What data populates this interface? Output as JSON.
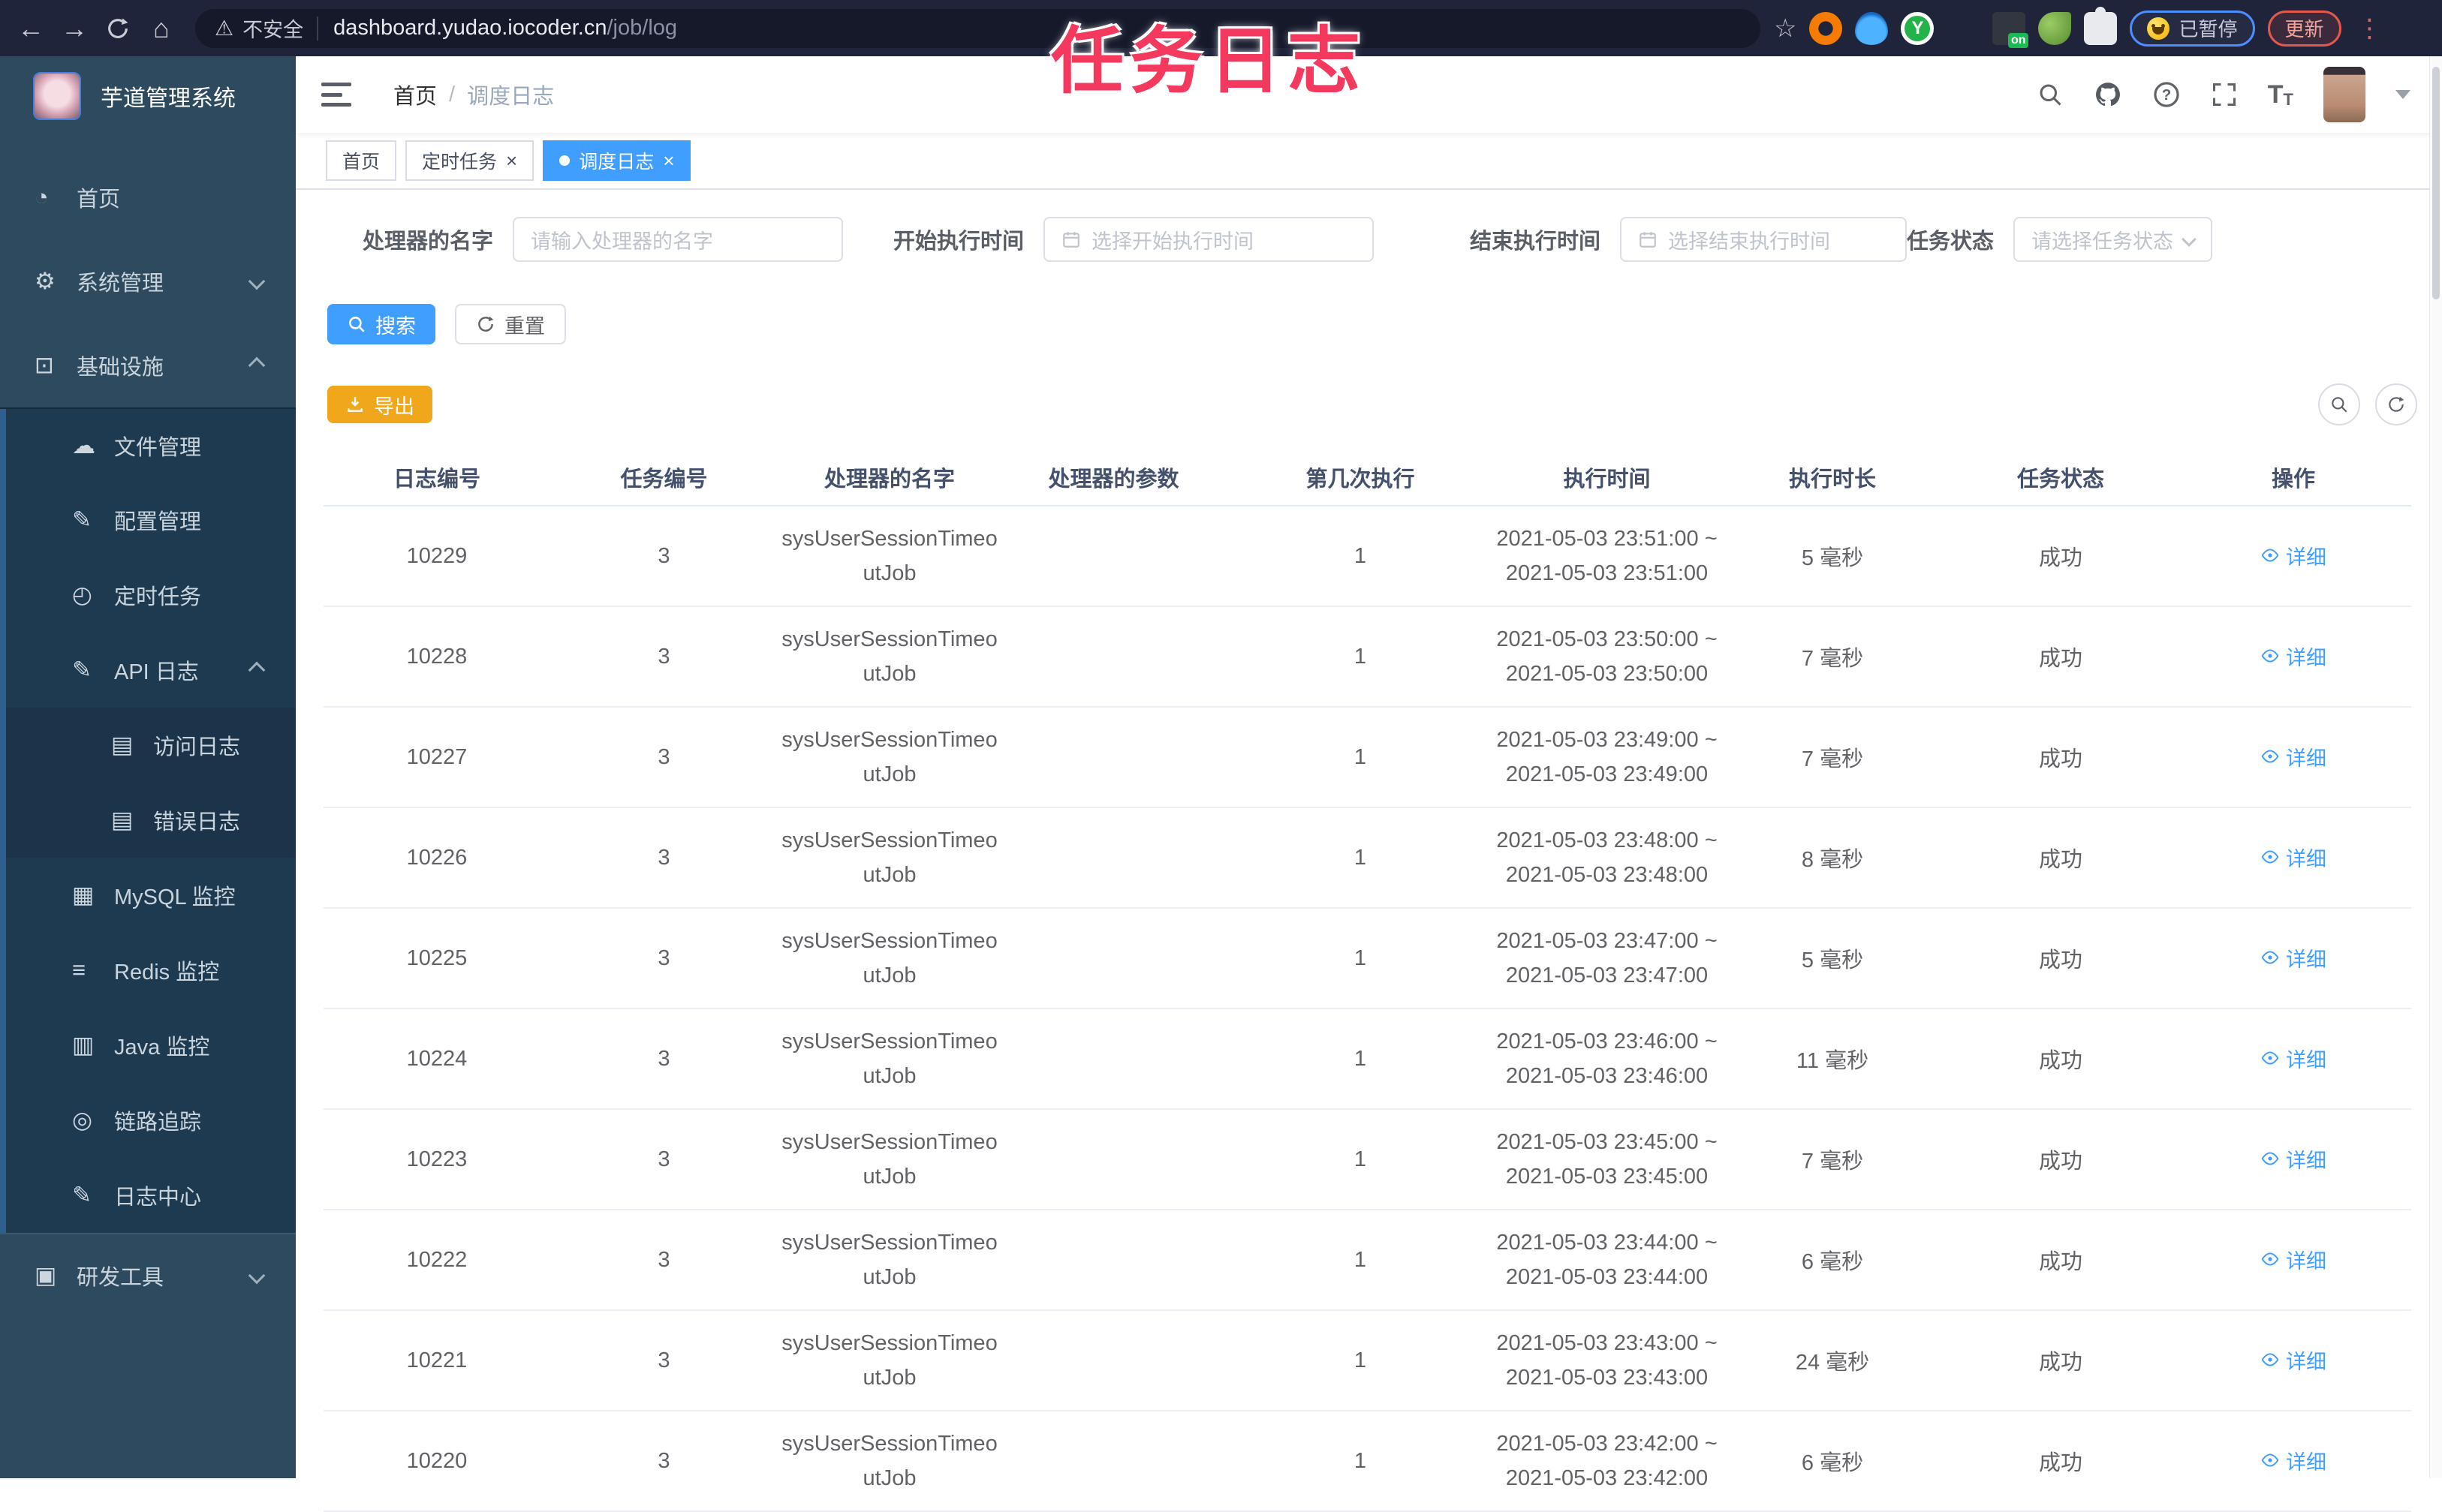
{
  "watermark": "任务日志",
  "browser": {
    "security_label": "不安全",
    "url_host": "dashboard.yudao.iocoder.cn",
    "url_path": "/job/log",
    "extension_badge": "on",
    "paused_badge": "已暂停",
    "update_badge": "更新"
  },
  "sidebar": {
    "app_title": "芋道管理系统",
    "items": [
      {
        "icon": "dashboard-icon",
        "label": "首页",
        "level": 1
      },
      {
        "icon": "gear-icon",
        "label": "系统管理",
        "level": 1,
        "chevron": "down"
      },
      {
        "icon": "infrastructure-icon",
        "label": "基础设施",
        "level": 1,
        "chevron": "up"
      },
      {
        "icon": "cloud-upload-icon",
        "label": "文件管理",
        "level": 2
      },
      {
        "icon": "edit-icon",
        "label": "配置管理",
        "level": 2
      },
      {
        "icon": "timer-icon",
        "label": "定时任务",
        "level": 2
      },
      {
        "icon": "api-log-icon",
        "label": "API 日志",
        "level": 2,
        "chevron": "up"
      },
      {
        "icon": "access-log-icon",
        "label": "访问日志",
        "level": 3
      },
      {
        "icon": "error-log-icon",
        "label": "错误日志",
        "level": 3
      },
      {
        "icon": "mysql-icon",
        "label": "MySQL 监控",
        "level": 2
      },
      {
        "icon": "redis-icon",
        "label": "Redis 监控",
        "level": 2
      },
      {
        "icon": "java-icon",
        "label": "Java 监控",
        "level": 2
      },
      {
        "icon": "trace-icon",
        "label": "链路追踪",
        "level": 2
      },
      {
        "icon": "log-center-icon",
        "label": "日志中心",
        "level": 2
      },
      {
        "icon": "toolbox-icon",
        "label": "研发工具",
        "level": 1,
        "chevron": "down"
      }
    ]
  },
  "header": {
    "breadcrumb_home": "首页",
    "breadcrumb_sep": "/",
    "breadcrumb_current": "调度日志"
  },
  "tabs": [
    {
      "label": "首页"
    },
    {
      "label": "定时任务",
      "closable": true
    },
    {
      "label": "调度日志",
      "closable": true,
      "active": true
    }
  ],
  "filters": [
    {
      "label": "处理器的名字",
      "placeholder": "请输入处理器的名字"
    },
    {
      "label": "开始执行时间",
      "placeholder": "选择开始执行时间",
      "date_icon": true
    },
    {
      "label": "结束执行时间",
      "placeholder": "选择结束执行时间",
      "date_icon": true
    },
    {
      "label": "任务状态",
      "placeholder": "请选择任务状态",
      "select_chevron": true
    }
  ],
  "actions": {
    "search_label": "搜索",
    "reset_label": "重置",
    "export_label": "导出"
  },
  "table": {
    "columns": [
      "日志编号",
      "任务编号",
      "处理器的名字",
      "处理器的参数",
      "第几次执行",
      "执行时间",
      "执行时长",
      "任务状态",
      "操作"
    ],
    "time_joiner": "~",
    "action_label": "详细",
    "rows": [
      {
        "log_id": "10229",
        "job_id": "3",
        "handler_name": "sysUserSessionTimeoutJob",
        "param": "",
        "exec_index": "1",
        "exec_time_start": "2021-05-03 23:51:00",
        "exec_time_end": "2021-05-03 23:51:00",
        "duration": "5 毫秒",
        "status": "成功"
      },
      {
        "log_id": "10228",
        "job_id": "3",
        "handler_name": "sysUserSessionTimeoutJob",
        "param": "",
        "exec_index": "1",
        "exec_time_start": "2021-05-03 23:50:00",
        "exec_time_end": "2021-05-03 23:50:00",
        "duration": "7 毫秒",
        "status": "成功"
      },
      {
        "log_id": "10227",
        "job_id": "3",
        "handler_name": "sysUserSessionTimeoutJob",
        "param": "",
        "exec_index": "1",
        "exec_time_start": "2021-05-03 23:49:00",
        "exec_time_end": "2021-05-03 23:49:00",
        "duration": "7 毫秒",
        "status": "成功"
      },
      {
        "log_id": "10226",
        "job_id": "3",
        "handler_name": "sysUserSessionTimeoutJob",
        "param": "",
        "exec_index": "1",
        "exec_time_start": "2021-05-03 23:48:00",
        "exec_time_end": "2021-05-03 23:48:00",
        "duration": "8 毫秒",
        "status": "成功"
      },
      {
        "log_id": "10225",
        "job_id": "3",
        "handler_name": "sysUserSessionTimeoutJob",
        "param": "",
        "exec_index": "1",
        "exec_time_start": "2021-05-03 23:47:00",
        "exec_time_end": "2021-05-03 23:47:00",
        "duration": "5 毫秒",
        "status": "成功"
      },
      {
        "log_id": "10224",
        "job_id": "3",
        "handler_name": "sysUserSessionTimeoutJob",
        "param": "",
        "exec_index": "1",
        "exec_time_start": "2021-05-03 23:46:00",
        "exec_time_end": "2021-05-03 23:46:00",
        "duration": "11 毫秒",
        "status": "成功"
      },
      {
        "log_id": "10223",
        "job_id": "3",
        "handler_name": "sysUserSessionTimeoutJob",
        "param": "",
        "exec_index": "1",
        "exec_time_start": "2021-05-03 23:45:00",
        "exec_time_end": "2021-05-03 23:45:00",
        "duration": "7 毫秒",
        "status": "成功"
      },
      {
        "log_id": "10222",
        "job_id": "3",
        "handler_name": "sysUserSessionTimeoutJob",
        "param": "",
        "exec_index": "1",
        "exec_time_start": "2021-05-03 23:44:00",
        "exec_time_end": "2021-05-03 23:44:00",
        "duration": "6 毫秒",
        "status": "成功"
      },
      {
        "log_id": "10221",
        "job_id": "3",
        "handler_name": "sysUserSessionTimeoutJob",
        "param": "",
        "exec_index": "1",
        "exec_time_start": "2021-05-03 23:43:00",
        "exec_time_end": "2021-05-03 23:43:00",
        "duration": "24 毫秒",
        "status": "成功"
      },
      {
        "log_id": "10220",
        "job_id": "3",
        "handler_name": "sysUserSessionTimeoutJob",
        "param": "",
        "exec_index": "1",
        "exec_time_start": "2021-05-03 23:42:00",
        "exec_time_end": "2021-05-03 23:42:00",
        "duration": "6 毫秒",
        "status": "成功"
      }
    ]
  }
}
